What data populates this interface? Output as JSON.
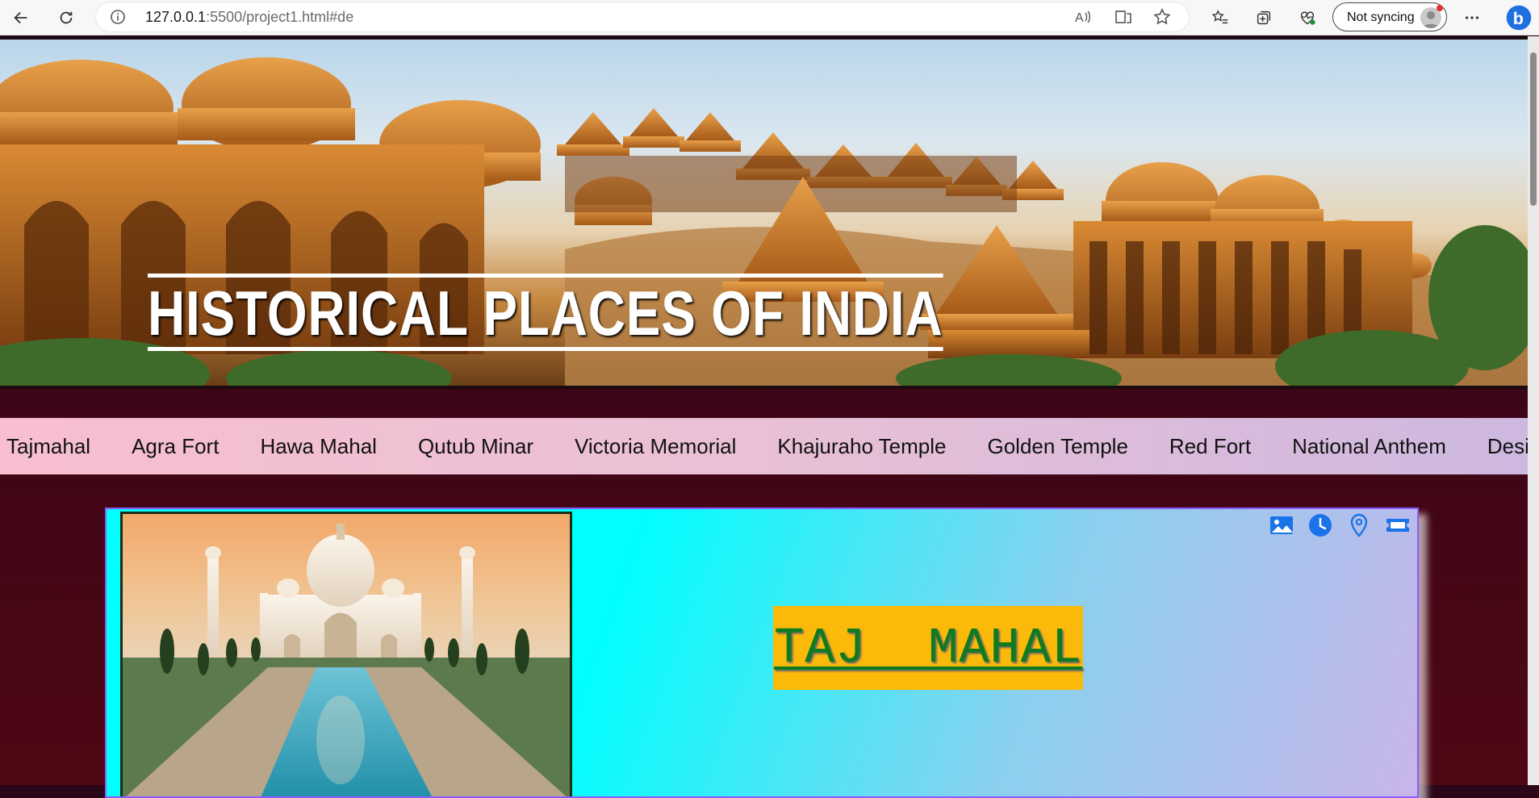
{
  "browser": {
    "url_host": "127.0.0.1",
    "url_rest": ":5500/project1.html#de",
    "sync_label": "Not syncing"
  },
  "hero": {
    "title": "HISTORICAL PLACES OF INDIA"
  },
  "nav": {
    "items": [
      "Tajmahal",
      "Agra Fort",
      "Hawa Mahal",
      "Qutub Minar",
      "Victoria Memorial",
      "Khajuraho Temple",
      "Golden Temple",
      "Red Fort",
      "National Anthem",
      "Design"
    ]
  },
  "card": {
    "title": "TAJ  MAHAL",
    "icons": [
      "image-icon",
      "clock-icon",
      "location-icon",
      "ticket-icon"
    ]
  },
  "colors": {
    "accent_blue": "#1a73e8",
    "title_box": "#fbb90a",
    "title_text": "#0f7a1e"
  }
}
